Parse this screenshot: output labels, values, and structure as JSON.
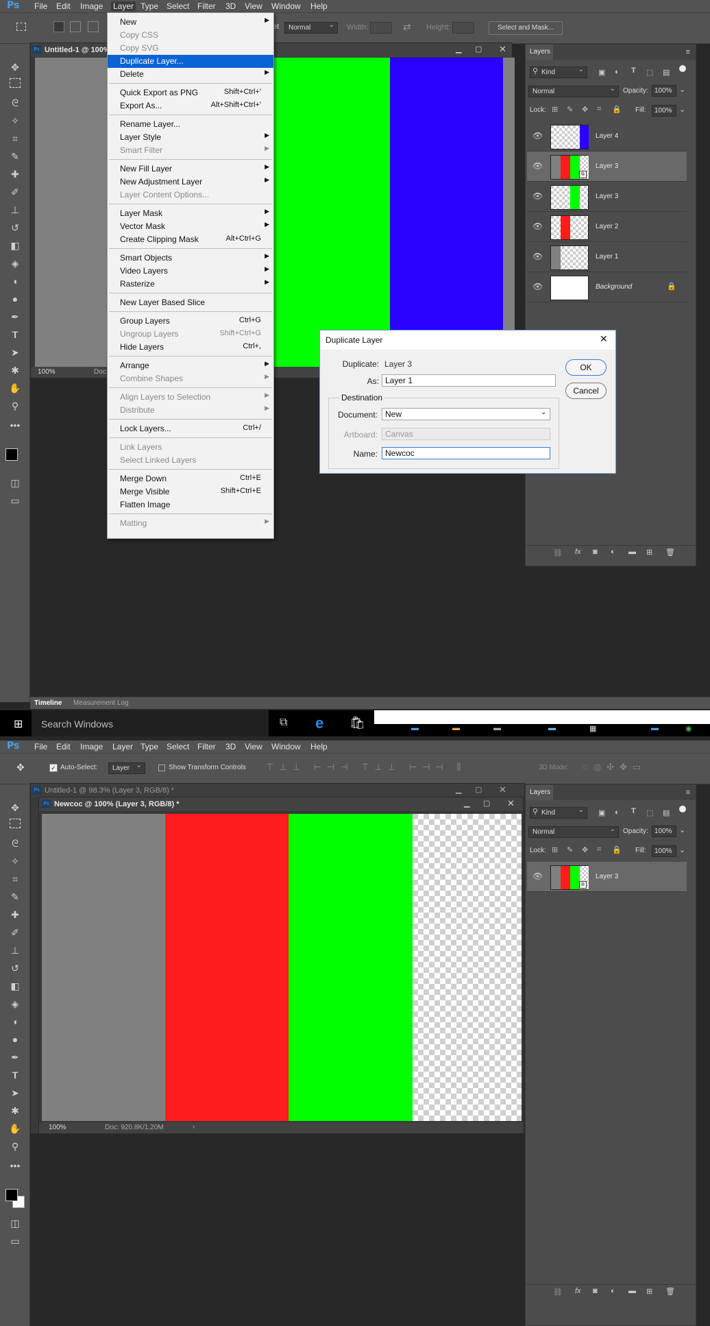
{
  "top": {
    "menubar": [
      "File",
      "Edit",
      "Image",
      "Layer",
      "Type",
      "Select",
      "Filter",
      "3D",
      "View",
      "Window",
      "Help"
    ],
    "logo": "Ps",
    "options": {
      "mode_label": "Normal",
      "width_label": "Width:",
      "height_label": "Height:",
      "select_mask": "Select and Mask...",
      "style_prefix": "et"
    },
    "doc_tab": "Untitled-1 @ 100%",
    "zoom": "100%",
    "doc_prefix": "Doc",
    "layer_menu": [
      {
        "label": "New",
        "arrow": true
      },
      {
        "label": "Copy CSS",
        "disabled": true
      },
      {
        "label": "Copy SVG",
        "disabled": true
      },
      {
        "label": "Duplicate Layer...",
        "highlight": true
      },
      {
        "label": "Delete",
        "arrow": true
      },
      {
        "sep": true
      },
      {
        "label": "Quick Export as PNG",
        "shortcut": "Shift+Ctrl+'"
      },
      {
        "label": "Export As...",
        "shortcut": "Alt+Shift+Ctrl+'"
      },
      {
        "sep": true
      },
      {
        "label": "Rename Layer..."
      },
      {
        "label": "Layer Style",
        "arrow": true
      },
      {
        "label": "Smart Filter",
        "arrow": true,
        "disabled": true
      },
      {
        "sep": true
      },
      {
        "label": "New Fill Layer",
        "arrow": true
      },
      {
        "label": "New Adjustment Layer",
        "arrow": true
      },
      {
        "label": "Layer Content Options...",
        "disabled": true
      },
      {
        "sep": true
      },
      {
        "label": "Layer Mask",
        "arrow": true
      },
      {
        "label": "Vector Mask",
        "arrow": true
      },
      {
        "label": "Create Clipping Mask",
        "shortcut": "Alt+Ctrl+G"
      },
      {
        "sep": true
      },
      {
        "label": "Smart Objects",
        "arrow": true
      },
      {
        "label": "Video Layers",
        "arrow": true
      },
      {
        "label": "Rasterize",
        "arrow": true
      },
      {
        "sep": true
      },
      {
        "label": "New Layer Based Slice"
      },
      {
        "sep": true
      },
      {
        "label": "Group Layers",
        "shortcut": "Ctrl+G"
      },
      {
        "label": "Ungroup Layers",
        "shortcut": "Shift+Ctrl+G",
        "disabled": true
      },
      {
        "label": "Hide Layers",
        "shortcut": "Ctrl+,"
      },
      {
        "sep": true
      },
      {
        "label": "Arrange",
        "arrow": true
      },
      {
        "label": "Combine Shapes",
        "arrow": true,
        "disabled": true
      },
      {
        "sep": true
      },
      {
        "label": "Align Layers to Selection",
        "arrow": true,
        "disabled": true
      },
      {
        "label": "Distribute",
        "arrow": true,
        "disabled": true
      },
      {
        "sep": true
      },
      {
        "label": "Lock Layers...",
        "shortcut": "Ctrl+/"
      },
      {
        "sep": true
      },
      {
        "label": "Link Layers",
        "disabled": true
      },
      {
        "label": "Select Linked Layers",
        "disabled": true
      },
      {
        "sep": true
      },
      {
        "label": "Merge Down",
        "shortcut": "Ctrl+E"
      },
      {
        "label": "Merge Visible",
        "shortcut": "Shift+Ctrl+E"
      },
      {
        "label": "Flatten Image"
      },
      {
        "sep": true
      },
      {
        "label": "Matting",
        "arrow": true,
        "disabled": true
      }
    ],
    "layers_panel": {
      "title": "Layers",
      "kind": "Kind",
      "blend": "Normal",
      "opacity_label": "Opacity:",
      "opacity": "100%",
      "lock_label": "Lock:",
      "fill_label": "Fill:",
      "fill": "100%",
      "layers": [
        {
          "name": "Layer 4"
        },
        {
          "name": "Layer 3",
          "selected": true
        },
        {
          "name": "Layer 3"
        },
        {
          "name": "Layer 2"
        },
        {
          "name": "Layer 1"
        },
        {
          "name": "Background"
        }
      ]
    },
    "dialog": {
      "title": "Duplicate Layer",
      "dup_label": "Duplicate:",
      "dup_value": "Layer 3",
      "as_label": "As:",
      "as_value": "Layer 1",
      "dest_label": "Destination",
      "doc_label": "Document:",
      "doc_value": "New",
      "artboard_label": "Artboard:",
      "artboard_value": "Canvas",
      "name_label": "Name:",
      "name_value": "Newcoc",
      "ok": "OK",
      "cancel": "Cancel"
    },
    "bottom_tabs": [
      "Timeline",
      "Measurement Log"
    ]
  },
  "taskbar": {
    "search": "Search Windows"
  },
  "bottom": {
    "menubar": [
      "File",
      "Edit",
      "Image",
      "Layer",
      "Type",
      "Select",
      "Filter",
      "3D",
      "View",
      "Window",
      "Help"
    ],
    "logo": "Ps",
    "options": {
      "auto_select": "Auto-Select:",
      "layer_select": "Layer",
      "transform": "Show Transform Controls",
      "mode3d": "3D Mode:"
    },
    "doc_tab_back": "Untitled-1 @ 98.3% (Layer 3, RGB/8) *",
    "doc_tab_front": "Newcoc @ 100% (Layer 3, RGB/8) *",
    "zoom": "100%",
    "doc_info": "Doc: 920.8K/1.20M",
    "layers_panel": {
      "title": "Layers",
      "kind": "Kind",
      "blend": "Normal",
      "opacity_label": "Opacity:",
      "opacity": "100%",
      "lock_label": "Lock:",
      "fill_label": "Fill:",
      "fill": "100%",
      "layers": [
        {
          "name": "Layer 3"
        }
      ]
    }
  },
  "colors": {
    "red": "#ff1c1c",
    "green": "#00ff00",
    "blue": "#2a00ff",
    "gray": "#808080",
    "highlight": "#0a63d6"
  }
}
